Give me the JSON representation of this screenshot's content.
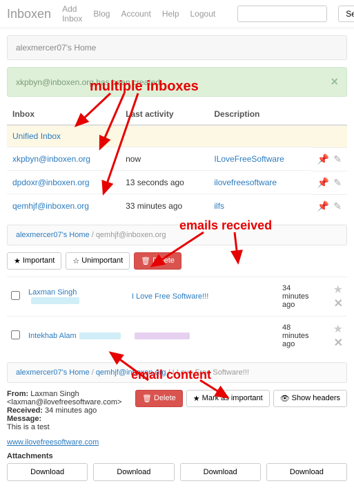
{
  "nav": {
    "brand": "Inboxen",
    "links": [
      "Add Inbox",
      "Blog",
      "Account",
      "Help",
      "Logout"
    ],
    "search": "Search"
  },
  "homeTitle": "alexmercer07's Home",
  "alert": "xkpbyn@inboxen.org has been created.",
  "headers": [
    "Inbox",
    "Last activity",
    "Description"
  ],
  "unified": "Unified Inbox",
  "rows": [
    {
      "addr": "xkpbyn@inboxen.org",
      "act": "now",
      "desc": "ILoveFreeSoftware"
    },
    {
      "addr": "dpdoxr@inboxen.org",
      "act": "13 seconds ago",
      "desc": "ilovefreesoftware"
    },
    {
      "addr": "qemhjf@inboxen.org",
      "act": "33 minutes ago",
      "desc": "ilfs"
    }
  ],
  "crumbA": "alexmercer07's Home",
  "crumbB": "qemhjf@inboxen.org",
  "btns": {
    "imp": "Important",
    "unimp": "Unimportant",
    "del": "Delete",
    "mark": "Mark as important",
    "show": "Show headers"
  },
  "emails": [
    {
      "from": "Laxman Singh",
      "subj": "I Love Free Software!!!",
      "time": "34 minutes ago"
    },
    {
      "from": "Intekhab Alam",
      "subj": "",
      "time": "48 minutes ago"
    }
  ],
  "crumbC": "I Love Free Software!!!",
  "meta": {
    "fromL": "From:",
    "fromV": "Laxman Singh <laxman@ilovefreesoftware.com>",
    "recvL": "Received:",
    "recvV": "34 minutes ago",
    "msgL": "Message:",
    "msgV": "This is a test",
    "url": "www.ilovefreesoftware.com"
  },
  "att": "Attachments",
  "dl": "Download",
  "ann": {
    "a1": "multiple inboxes",
    "a2": "emails received",
    "a3": "email content"
  }
}
